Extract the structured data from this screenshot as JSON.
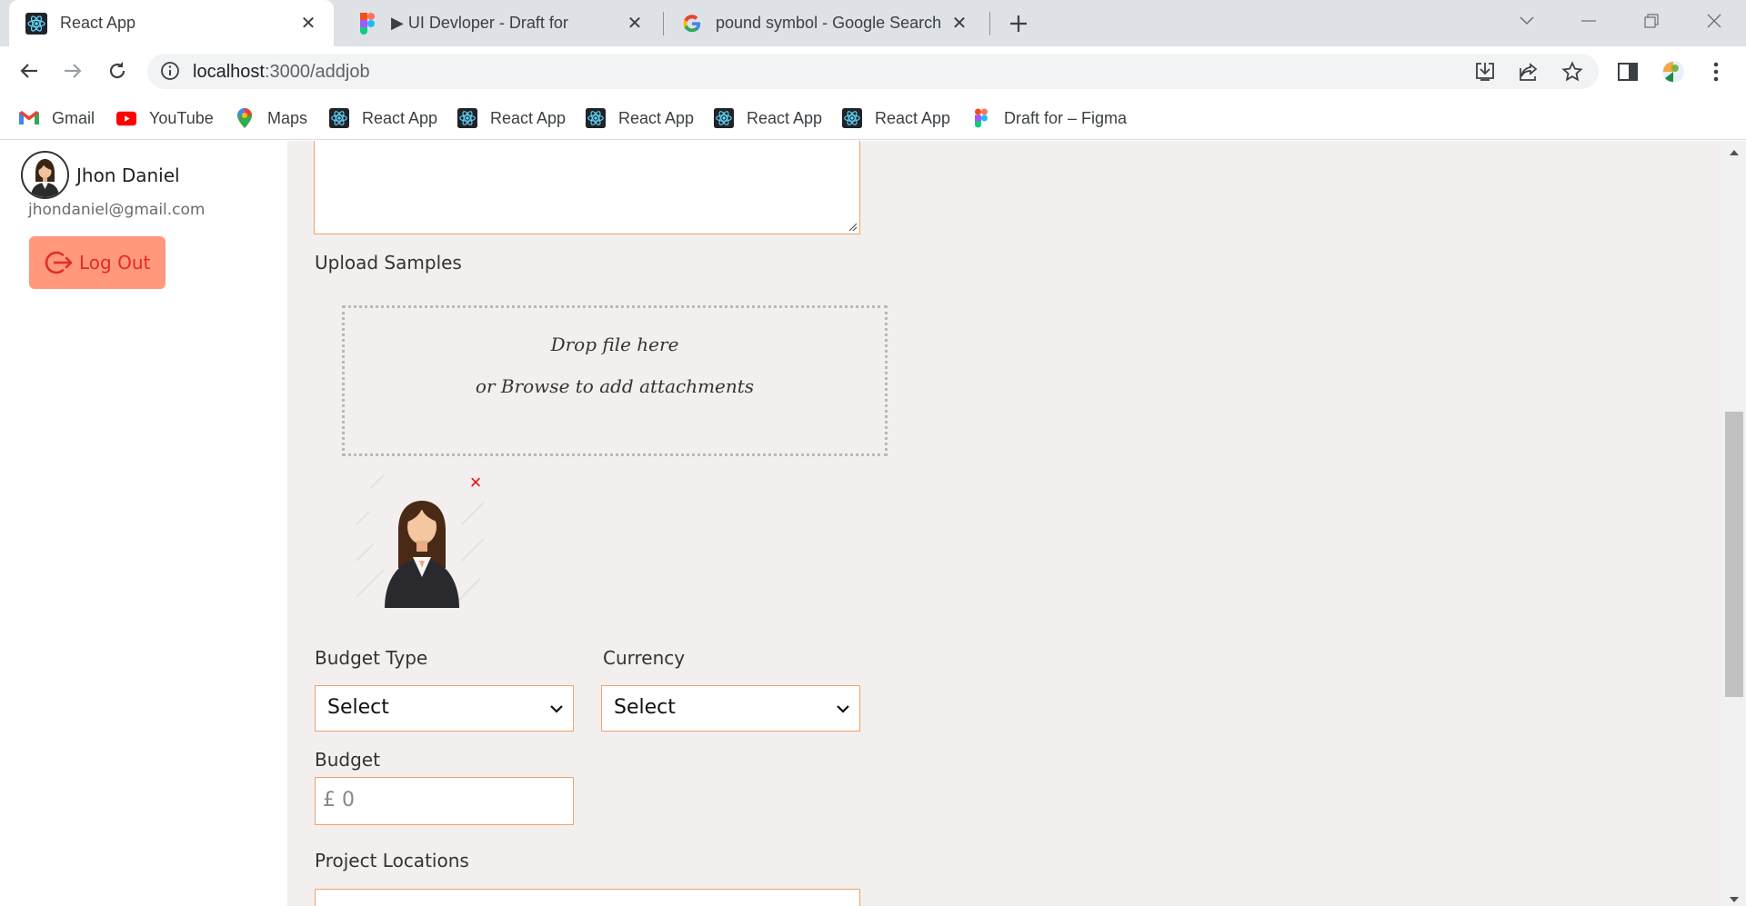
{
  "browser": {
    "tabs": [
      {
        "title": "React App",
        "icon": "react-icon",
        "active": true
      },
      {
        "title": "▶ UI Devloper - Draft for",
        "icon": "figma-icon",
        "active": false
      },
      {
        "title": "pound symbol - Google Search",
        "icon": "google-icon",
        "active": false
      }
    ],
    "url_host": "localhost",
    "url_path": ":3000/addjob",
    "bookmarks": [
      {
        "label": "Gmail",
        "icon": "gmail-icon"
      },
      {
        "label": "YouTube",
        "icon": "youtube-icon"
      },
      {
        "label": "Maps",
        "icon": "maps-icon"
      },
      {
        "label": "React App",
        "icon": "react-icon"
      },
      {
        "label": "React App",
        "icon": "react-icon"
      },
      {
        "label": "React App",
        "icon": "react-icon"
      },
      {
        "label": "React App",
        "icon": "react-icon"
      },
      {
        "label": "React App",
        "icon": "react-icon"
      },
      {
        "label": "Draft for – Figma",
        "icon": "figma-icon"
      }
    ]
  },
  "sidebar": {
    "user_name": "Jhon Daniel",
    "user_email": "jhondaniel@gmail.com",
    "logout_label": "Log Out"
  },
  "form": {
    "upload_label": "Upload Samples",
    "dropzone_line1": "Drop file here",
    "dropzone_line2": "or Browse to add attachments",
    "remove_symbol": "×",
    "budget_type_label": "Budget Type",
    "budget_type_value": "Select",
    "currency_label": "Currency",
    "currency_value": "Select",
    "budget_label": "Budget",
    "budget_placeholder": "£ 0",
    "project_locations_label": "Project Locations"
  },
  "colors": {
    "main_bg": "#f3efee",
    "field_border": "#f0a36a",
    "logout_bg": "#ff987d",
    "logout_text": "#e32b2b",
    "remove_x": "#e30c0c"
  }
}
